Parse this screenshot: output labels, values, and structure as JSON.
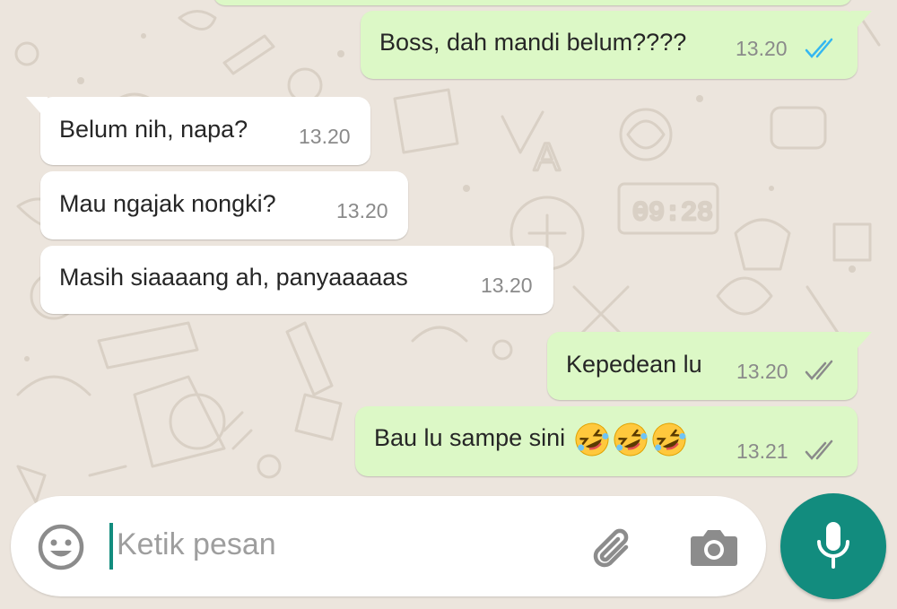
{
  "colors": {
    "background": "#ece5dd",
    "incoming_bubble": "#ffffff",
    "outgoing_bubble": "#dcf8c6",
    "accent": "#128c7e",
    "read_ticks": "#34b7f1",
    "sent_ticks": "#8a8a8a"
  },
  "messages": [
    {
      "direction": "outgoing",
      "text": "Boss, dah mandi belum????",
      "time": "13.20",
      "status": "read"
    },
    {
      "direction": "incoming",
      "text": "Belum nih, napa?",
      "time": "13.20"
    },
    {
      "direction": "incoming",
      "text": "Mau ngajak nongki?",
      "time": "13.20"
    },
    {
      "direction": "incoming",
      "text": "Masih siaaaang ah, panyaaaaas",
      "time": "13.20"
    },
    {
      "direction": "outgoing",
      "text": "Kepedean lu",
      "time": "13.20",
      "status": "delivered"
    },
    {
      "direction": "outgoing",
      "text": "Bau lu sampe sini",
      "emoji": [
        "rolling-on-floor-laughing",
        "rolling-on-floor-laughing",
        "rolling-on-floor-laughing"
      ],
      "time": "13.21",
      "status": "delivered"
    }
  ],
  "composer": {
    "placeholder": "Ketik pesan",
    "icons": [
      "emoji-icon",
      "attachment-icon",
      "camera-icon",
      "microphone-icon"
    ]
  }
}
